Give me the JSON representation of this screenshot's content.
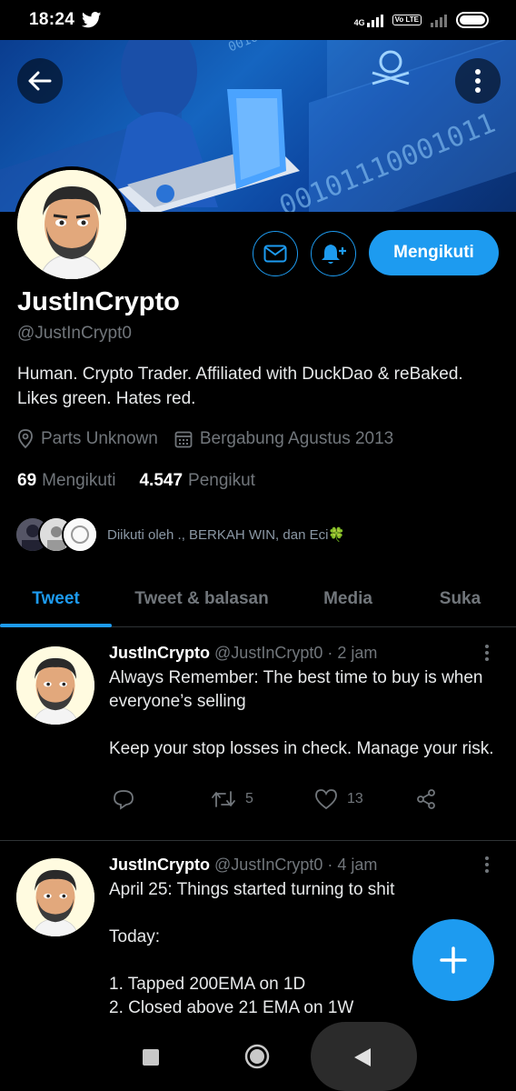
{
  "status_bar": {
    "time": "18:24",
    "network_tag": "4G",
    "volte_tag": "Vo LTE"
  },
  "profile": {
    "name": "JustInCrypto",
    "handle": "@JustInCrypt0",
    "bio": "Human. Crypto Trader. Affiliated with DuckDao & reBaked. Likes green. Hates red.",
    "location": "Parts Unknown",
    "joined": "Bergabung Agustus 2013",
    "following_count": "69",
    "following_label": "Mengikuti",
    "followers_count": "4.547",
    "followers_label": "Pengikut",
    "followed_by": "Diikuti oleh ., BERKAH WIN, dan Eci🍀",
    "follow_button": "Mengikuti"
  },
  "banner": {
    "binary_text_1": "00101110001011",
    "binary_text_2": "0010110"
  },
  "tabs": [
    {
      "label": "Tweet",
      "active": true
    },
    {
      "label": "Tweet & balasan",
      "active": false
    },
    {
      "label": "Media",
      "active": false
    },
    {
      "label": "Suka",
      "active": false
    }
  ],
  "tweets": [
    {
      "author": "JustInCrypto",
      "handle": "@JustInCrypt0",
      "time": "· 2 jam",
      "text": "Always Remember: The best time to buy is when everyone’s selling\n\nKeep your stop losses in check. Manage your risk.",
      "retweets": "5",
      "likes": "13"
    },
    {
      "author": "JustInCrypto",
      "handle": "@JustInCrypt0",
      "time": "· 4 jam",
      "text": "April 25: Things started turning to shit\n\nToday:\n\n1. Tapped 200EMA on 1D\n2. Closed above 21 EMA on 1W"
    }
  ],
  "colors": {
    "accent": "#1d9bf0",
    "background": "#000000",
    "muted_text": "#71767b"
  },
  "icons": [
    "back-arrow-icon",
    "more-vertical-icon",
    "mail-icon",
    "bell-plus-icon",
    "location-pin-icon",
    "calendar-icon",
    "reply-icon",
    "retweet-icon",
    "like-icon",
    "share-icon",
    "compose-plus-icon",
    "nav-square-icon",
    "nav-home-icon",
    "nav-back-icon"
  ]
}
